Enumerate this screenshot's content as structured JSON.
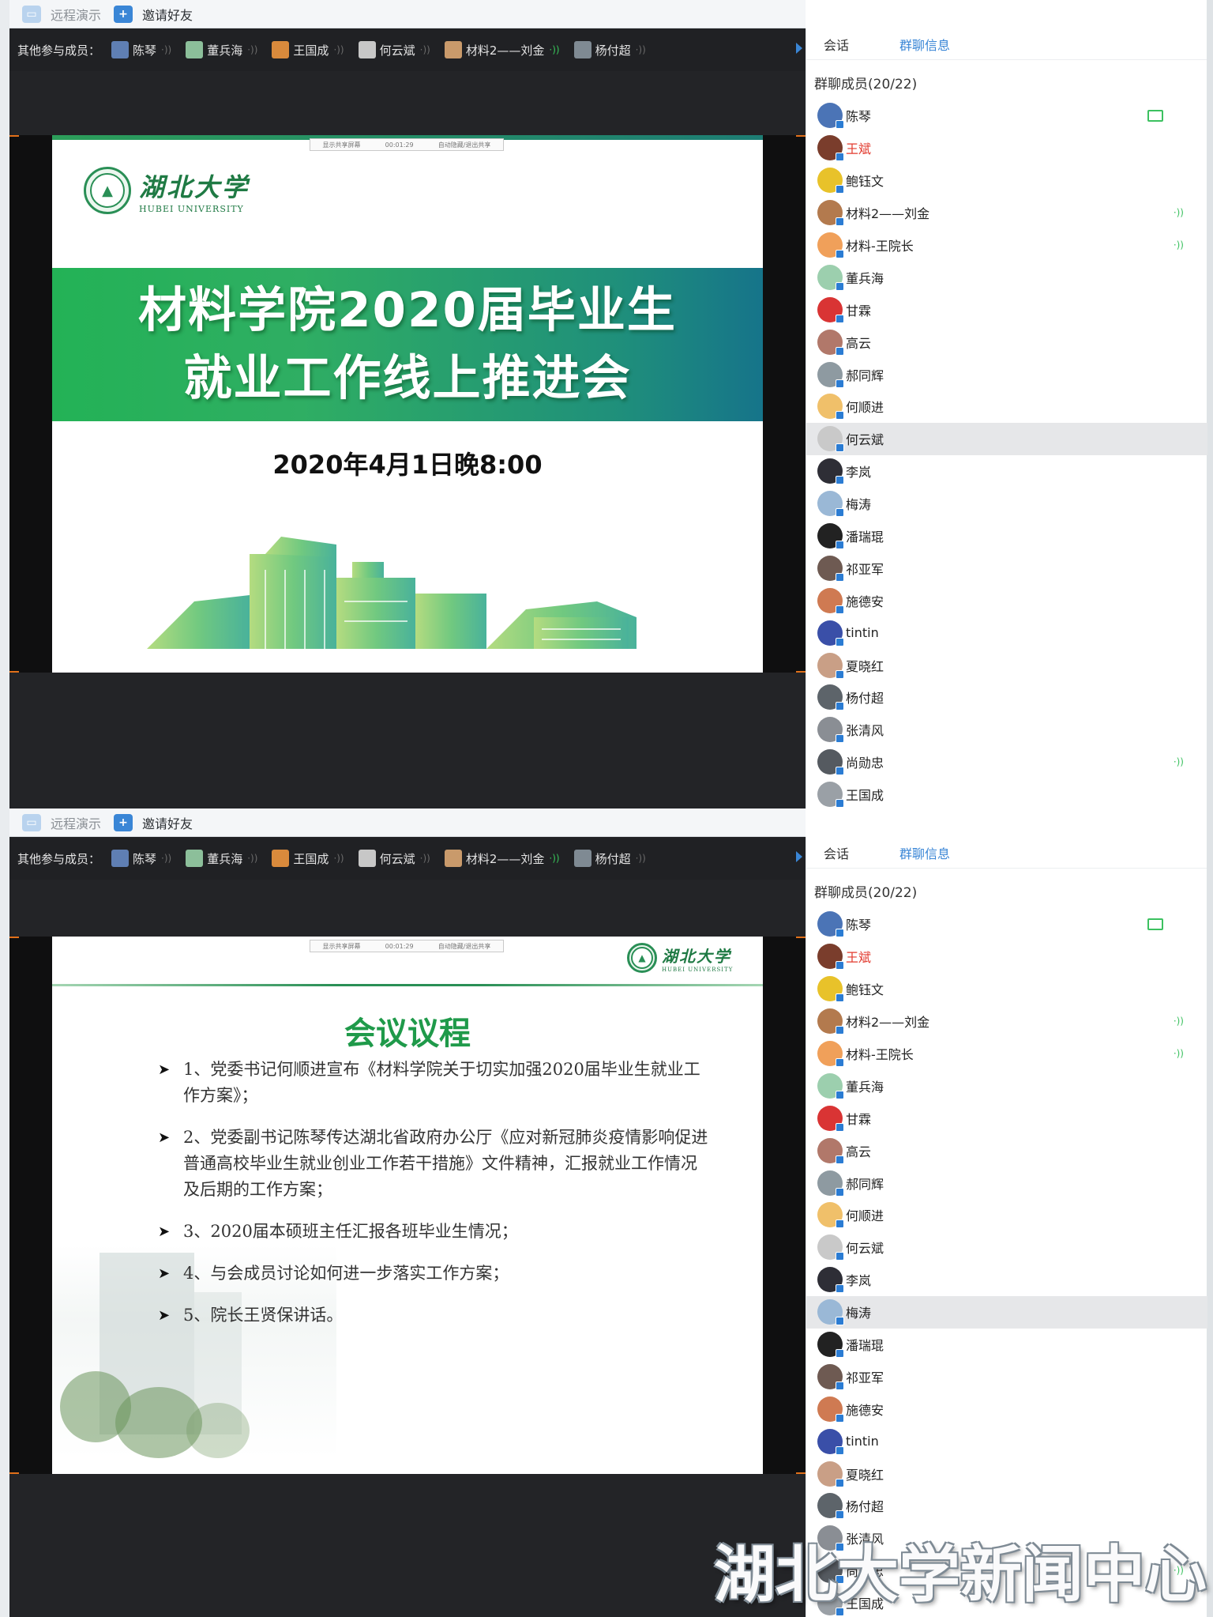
{
  "toolbar": {
    "remote_label": "远程演示",
    "invite_label": "邀请好友"
  },
  "strip": {
    "label": "其他参与成员：",
    "members": [
      {
        "name": "陈琴",
        "color": "#5f7fb3",
        "speaking": false
      },
      {
        "name": "董兵海",
        "color": "#8cbf9a",
        "speaking": false
      },
      {
        "name": "王国成",
        "color": "#d98a3c",
        "speaking": false
      },
      {
        "name": "何云斌",
        "color": "#c7c7c7",
        "speaking": false
      },
      {
        "name": "材料2——刘金",
        "color": "#c99a6b",
        "speaking": true
      },
      {
        "name": "杨付超",
        "color": "#7f8a93",
        "speaking": false
      }
    ]
  },
  "slide1": {
    "logo_cn": "湖北大学",
    "logo_en": "HUBEI UNIVERSITY",
    "title_line1": "材料学院2020届毕业生",
    "title_line2": "就业工作线上推进会",
    "date": "2020年4月1日晚8:00"
  },
  "slide2": {
    "logo_cn": "湖北大学",
    "logo_en": "HUBEI UNIVERSITY",
    "heading": "会议议程",
    "agenda": [
      "1、党委书记何顺进宣布《材料学院关于切实加强2020届毕业生就业工作方案》；",
      "2、党委副书记陈琴传达湖北省政府办公厅《应对新冠肺炎疫情影响促进普通高校毕业生就业创业工作若干措施》文件精神，汇报就业工作情况及后期的工作方案；",
      "3、2020届本硕班主任汇报各班毕业生情况；",
      "4、与会成员讨论如何进一步落实工作方案；",
      "5、院长王贤保讲话。"
    ]
  },
  "ctrl_bar": {
    "item1": "显示共享屏幕",
    "item2": "00:01:29",
    "item3": "自动隐藏/退出共享"
  },
  "sidebar": {
    "tab_chat": "会话",
    "tab_info": "群聊信息",
    "members_title": "群聊成员(20/22)",
    "members": [
      {
        "name": "陈琴",
        "color": "#4b74b6",
        "red": false,
        "vol": false,
        "screen": true
      },
      {
        "name": "王斌",
        "color": "#7a3d2c",
        "red": true,
        "vol": false,
        "screen": false
      },
      {
        "name": "鲍钰文",
        "color": "#e8c22a",
        "red": false,
        "vol": false,
        "screen": false
      },
      {
        "name": "材料2——刘金",
        "color": "#b37a4e",
        "red": false,
        "vol": true,
        "screen": false
      },
      {
        "name": "材料-王院长",
        "color": "#f0a05a",
        "red": false,
        "vol": true,
        "screen": false
      },
      {
        "name": "董兵海",
        "color": "#9ccfae",
        "red": false,
        "vol": false,
        "screen": false
      },
      {
        "name": "甘霖",
        "color": "#d93434",
        "red": false,
        "vol": false,
        "screen": false
      },
      {
        "name": "高云",
        "color": "#b1786a",
        "red": false,
        "vol": false,
        "screen": false
      },
      {
        "name": "郝同辉",
        "color": "#8e9aa1",
        "red": false,
        "vol": false,
        "screen": false
      },
      {
        "name": "何顺进",
        "color": "#f0c06a",
        "red": false,
        "vol": false,
        "screen": false
      },
      {
        "name": "何云斌",
        "color": "#c9c9c9",
        "red": false,
        "vol": false,
        "screen": false
      },
      {
        "name": "李岚",
        "color": "#2e2e36",
        "red": false,
        "vol": false,
        "screen": false
      },
      {
        "name": "梅涛",
        "color": "#9ab8d6",
        "red": false,
        "vol": false,
        "screen": false
      },
      {
        "name": "潘瑞琨",
        "color": "#222222",
        "red": false,
        "vol": false,
        "screen": false
      },
      {
        "name": "祁亚军",
        "color": "#6e5a52",
        "red": false,
        "vol": false,
        "screen": false
      },
      {
        "name": "施德安",
        "color": "#cf7a52",
        "red": false,
        "vol": false,
        "screen": false
      },
      {
        "name": "tintin",
        "color": "#3a4fa8",
        "red": false,
        "vol": false,
        "screen": false
      },
      {
        "name": "夏晓红",
        "color": "#c99f86",
        "red": false,
        "vol": false,
        "screen": false
      },
      {
        "name": "杨付超",
        "color": "#5d646a",
        "red": false,
        "vol": false,
        "screen": false
      },
      {
        "name": "张清风",
        "color": "#8a8e94",
        "red": false,
        "vol": false,
        "screen": false
      },
      {
        "name": "尚勋忠",
        "color": "#555a60",
        "red": false,
        "vol": true,
        "screen": false
      },
      {
        "name": "王国成",
        "color": "#9aa0a6",
        "red": false,
        "vol": false,
        "screen": false
      }
    ],
    "vol_glyph": "·))"
  },
  "watermark": "湖北大学新闻中心",
  "colors": {
    "accent": "#3a86d6",
    "slide_green": "#1f9a4a",
    "speaking": "#38c75a",
    "name_red": "#e23a2e"
  }
}
